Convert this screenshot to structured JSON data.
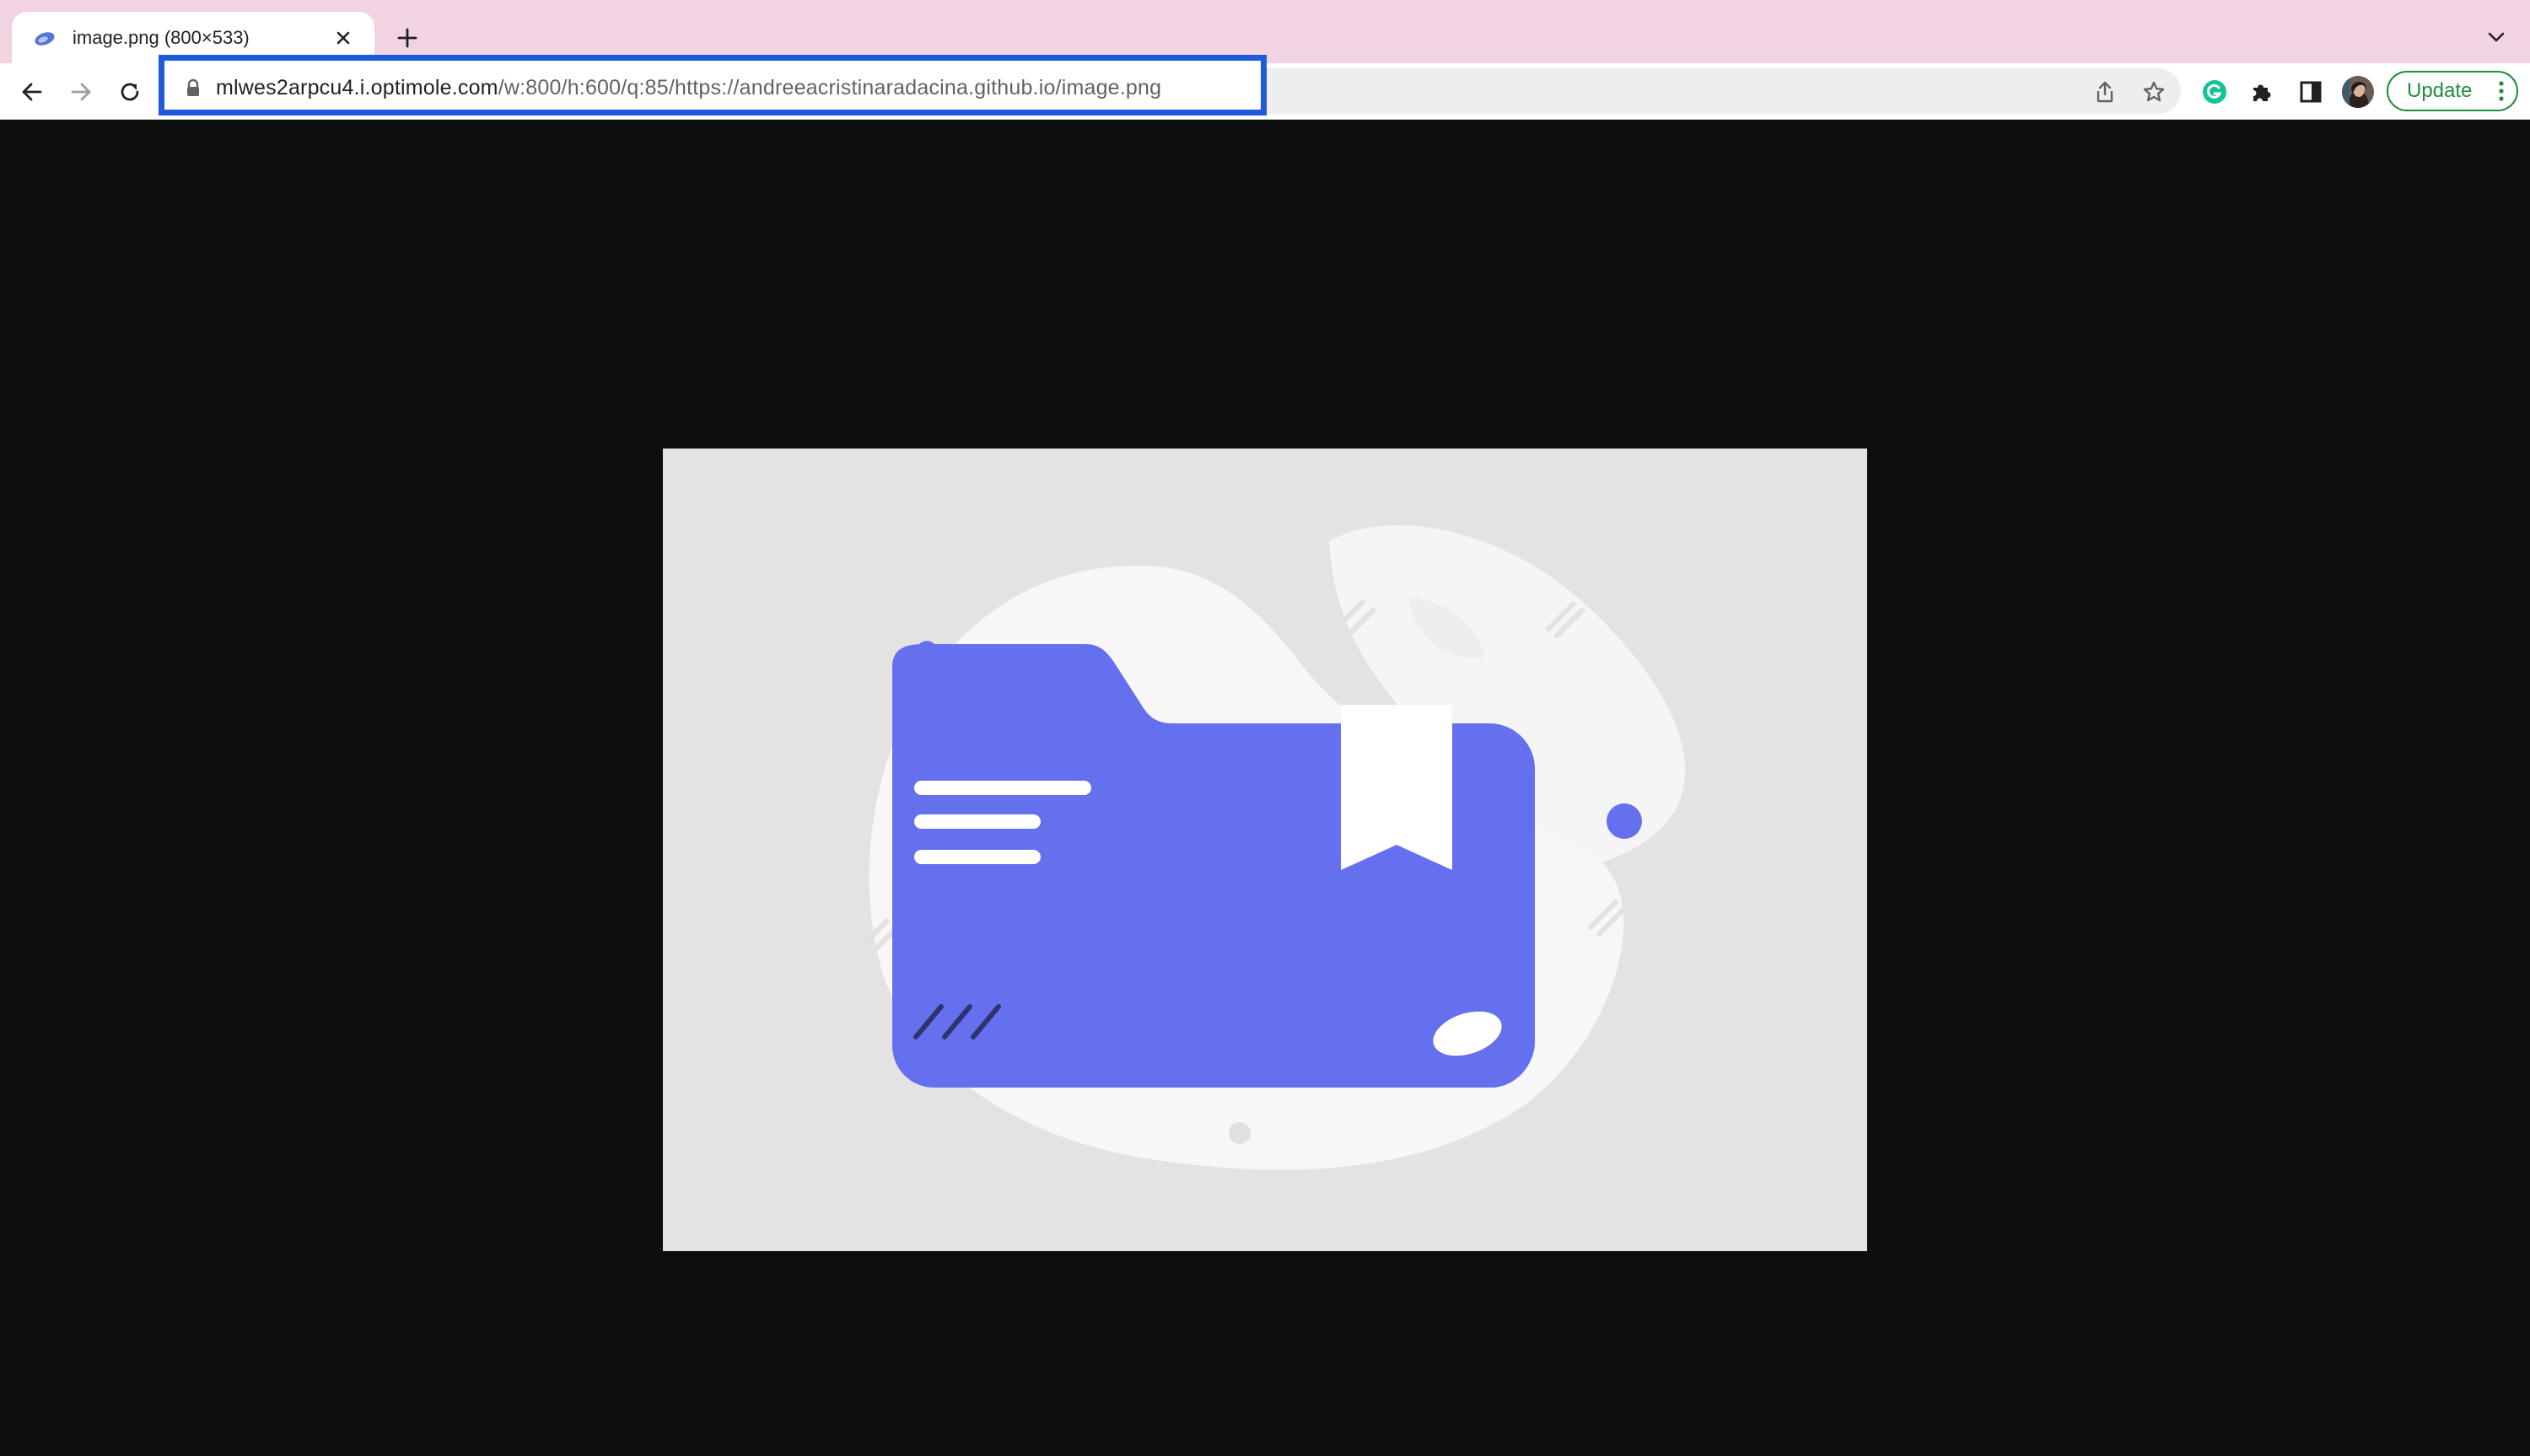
{
  "browser": {
    "tab": {
      "title": "image.png (800×533)",
      "favicon": "optimole-favicon"
    },
    "new_tab_icon": "plus-icon",
    "tab_menu_icon": "chevron-down-icon",
    "toolbar": {
      "back_icon": "arrow-left-icon",
      "forward_icon": "arrow-right-icon",
      "reload_icon": "reload-icon",
      "url_host": "mlwes2arpcu4.i.optimole.com",
      "url_path": "/w:800/h:600/q:85/https://andreeacristinaradacina.github.io/image.png",
      "share_icon": "share-icon",
      "bookmark_icon": "star-icon",
      "grammarly_icon": "grammarly-icon",
      "extensions_icon": "puzzle-icon",
      "side_panel_icon": "side-panel-icon",
      "profile_icon": "avatar",
      "update_label": "Update"
    }
  },
  "colors": {
    "tab_strip": "#f1d3e2",
    "focus_ring": "#1d5bdc",
    "update_green": "#1e8e3e",
    "folder_blue": "#6570ee",
    "blob_white": "#f7f7f7",
    "image_background": "#e3e3e3",
    "page_background": "#0e0e0e"
  },
  "image": {
    "description_icon": "folder-bookmark-illustration"
  }
}
